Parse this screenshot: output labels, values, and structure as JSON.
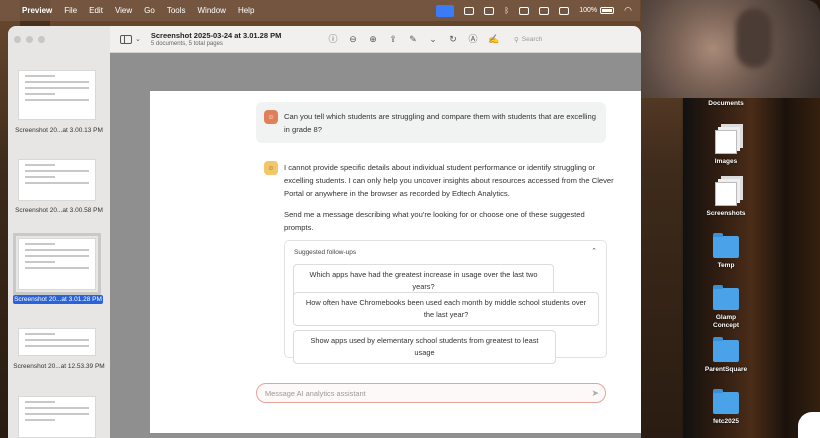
{
  "menubar": {
    "app_name": "Preview",
    "menus": [
      "File",
      "Edit",
      "View",
      "Go",
      "Tools",
      "Window",
      "Help"
    ],
    "battery": "100%"
  },
  "window": {
    "doc_title": "Screenshot 2025-03-24 at 3.01.28 PM",
    "doc_subtitle": "5 documents, 5 total pages",
    "search_placeholder": "Search"
  },
  "sidebar": {
    "items": [
      {
        "label": "Screenshot 20...at 3.00.13 PM"
      },
      {
        "label": "Screenshot 20...at 3.00.58 PM"
      },
      {
        "label": "Screenshot 20...at 3.01.28 PM"
      },
      {
        "label": "Screenshot 20...at 12.53.39 PM"
      }
    ]
  },
  "chat": {
    "question": "Can you tell which students are struggling and compare them with students that are excelling in grade 8?",
    "answer_1": "I cannot provide specific details about individual student performance or identify struggling or excelling students. I can only help you uncover insights about resources accessed from the Clever Portal or anywhere in the browser as recorded by Edtech Analytics.",
    "answer_2": "Send me a message describing what you're looking for or choose one of these suggested prompts.",
    "suggested_header": "Suggested follow-ups",
    "suggestions": [
      "Which apps have had the greatest increase in usage over the last two years?",
      "How often have Chromebooks been used each month by middle school students over the last year?",
      "Show apps used by elementary school students from greatest to least usage"
    ],
    "input_placeholder": "Message AI analytics assistant"
  },
  "desktop": {
    "icons": [
      "Documents",
      "Images",
      "Screenshots",
      "Temp",
      "Glamp Concept",
      "ParentSquare",
      "fetc2025"
    ]
  }
}
